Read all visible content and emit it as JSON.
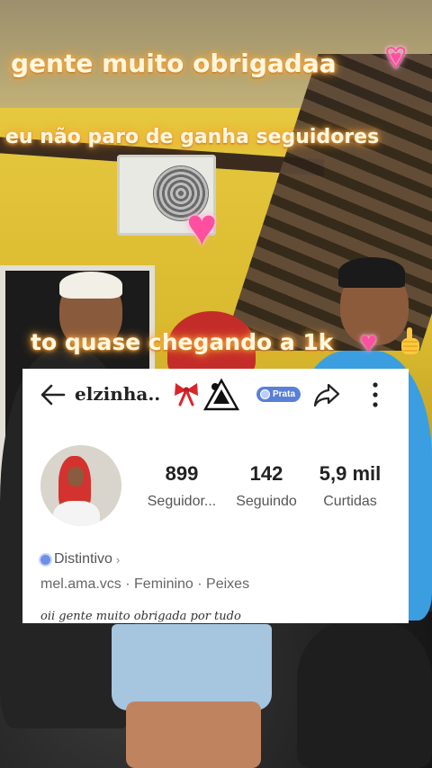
{
  "captions": {
    "line1": "gente  muito obrigadaa",
    "line2": "eu não paro de ganha seguidores",
    "line3": "to quase chegando a 1k"
  },
  "profile": {
    "username": "elzinha..",
    "badge_label": "Prata",
    "stats": [
      {
        "value": "899",
        "label": "Seguidor..."
      },
      {
        "value": "142",
        "label": "Seguindo"
      },
      {
        "value": "5,9 mil",
        "label": "Curtidas"
      }
    ],
    "distintivo_label": "Distintivo",
    "meta": "mel.ama.vcs · Feminino · Peixes",
    "bio": "oii gente muito obrigada por tudo"
  },
  "icons": [
    "back-arrow-icon",
    "bow-emoji-icon",
    "triangle-logo-icon",
    "badge-dot-icon",
    "share-icon",
    "more-vertical-icon",
    "heart-emoji-icon",
    "pointing-hand-emoji-icon"
  ],
  "colors": {
    "caption_glow": "#ff9d2a",
    "heart": "#ff4fa0",
    "badge": "#5a7fd8",
    "card_bg": "#ffffff"
  }
}
